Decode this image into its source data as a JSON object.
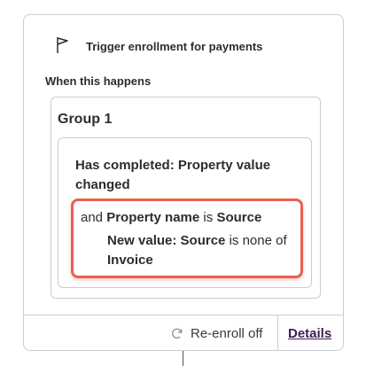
{
  "trigger": {
    "title": "Trigger enrollment for payments",
    "icon": "flag-icon"
  },
  "when_label": "When this happens",
  "group": {
    "title": "Group 1",
    "condition": {
      "heading": "Has completed: Property value changed",
      "line1": {
        "prefix": "and",
        "property": "Property name",
        "operator": "is",
        "value": "Source"
      },
      "line2": {
        "property": "New value: Source",
        "operator": "is none of",
        "value": "Invoice"
      }
    }
  },
  "footer": {
    "reenroll_label": "Re-enroll off",
    "details_label": "Details"
  },
  "colors": {
    "highlight": "#e8614f",
    "link": "#3b1f52",
    "border": "#c9cdd2"
  }
}
